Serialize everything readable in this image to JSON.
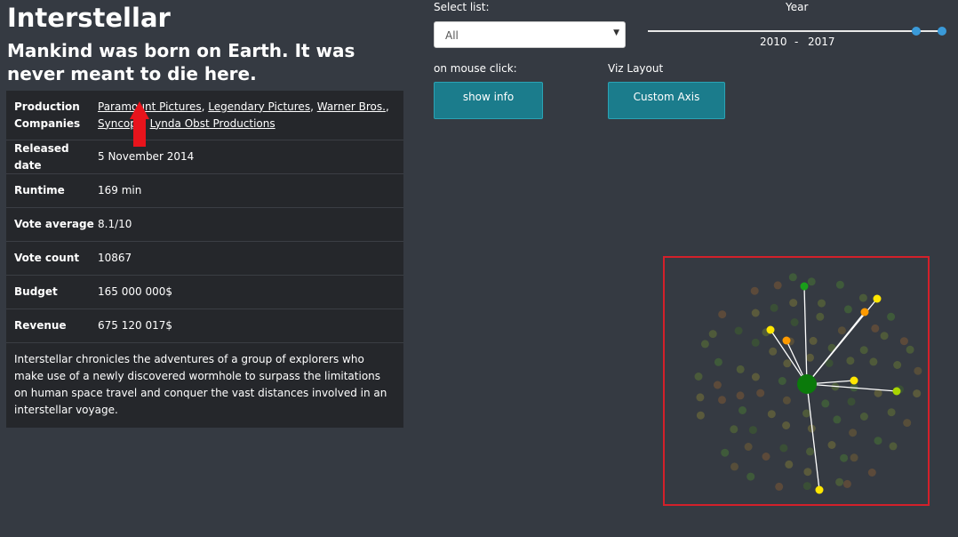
{
  "movie": {
    "title": "Interstellar",
    "tagline": "Mankind was born on Earth. It was never meant to die here.",
    "details": {
      "production_label": "Production Companies",
      "production_companies": [
        "Paramount Pictures",
        "Legendary Pictures",
        "Warner Bros.",
        "Syncopy",
        "Lynda Obst Productions"
      ],
      "released_label": "Released date",
      "released": "5 November 2014",
      "runtime_label": "Runtime",
      "runtime": "169 min",
      "vote_average_label": "Vote average",
      "vote_average": "8.1/10",
      "vote_count_label": "Vote count",
      "vote_count": "10867",
      "budget_label": "Budget",
      "budget": "165 000 000$",
      "revenue_label": "Revenue",
      "revenue": "675 120 017$"
    },
    "overview": "Interstellar chronicles the adventures of a group of explorers who make use of a newly discovered wormhole to surpass the limitations on human space travel and conquer the vast distances involved in an interstellar voyage."
  },
  "controls": {
    "select_list_label": "Select list:",
    "select_list_value": "All",
    "year_label": "Year",
    "year_start": "2010",
    "year_separator": "-",
    "year_end": "2017",
    "mouse_click_label": "on mouse click:",
    "show_info_button": "show info",
    "viz_layout_label": "Viz Layout",
    "custom_axis_button": "Custom Axis"
  },
  "colors": {
    "background": "#353a42",
    "table_bg": "#25272b",
    "button_bg": "#1b7c8c",
    "slider_handle": "#3a9ad9",
    "highlight_border": "#d3202a",
    "center_node": "#0b7a0b",
    "link": "#ffffff",
    "linked_nodes": [
      "#1a9e1a",
      "#ffe600",
      "#ff9a00",
      "#a8d400"
    ]
  },
  "icons": {
    "select_caret": "▼"
  }
}
